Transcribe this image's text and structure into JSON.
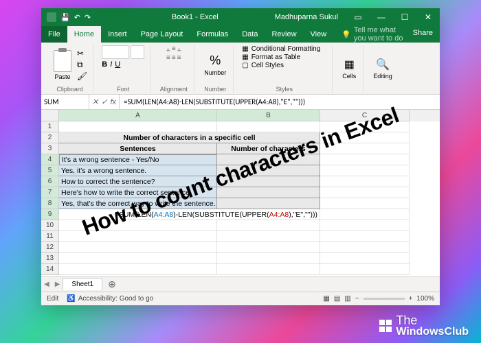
{
  "title": {
    "app": "Book1  -  Excel",
    "user": "Madhuparna Sukul"
  },
  "menu": {
    "file": "File",
    "home": "Home",
    "insert": "Insert",
    "page_layout": "Page Layout",
    "formulas": "Formulas",
    "data": "Data",
    "review": "Review",
    "view": "View",
    "tellme": "Tell me what you want to do",
    "share": "Share"
  },
  "ribbon": {
    "clipboard": {
      "paste": "Paste",
      "label": "Clipboard"
    },
    "font": {
      "label": "Font"
    },
    "alignment": {
      "label": "Alignment"
    },
    "number": {
      "btn": "Number",
      "label": "Number"
    },
    "styles": {
      "cond": "Conditional Formatting",
      "table": "Format as Table",
      "cell": "Cell Styles",
      "label": "Styles"
    },
    "cells": {
      "btn": "Cells"
    },
    "editing": {
      "btn": "Editing"
    }
  },
  "formula_bar": {
    "name": "SUM",
    "formula": "=SUM(LEN(A4:A8)-LEN(SUBSTITUTE(UPPER(A4:A8),\"E\",\"\")))"
  },
  "columns": [
    "A",
    "B",
    "C"
  ],
  "cells": {
    "r2_merged": "Number of characters in a specific cell",
    "r3_a": "Sentences",
    "r3_b": "Number of characters",
    "r4_a": "It's a wrong sentence - Yes/No",
    "r5_a": "Yes, it's a wrong sentence.",
    "r6_a": "How to correct the sentence?",
    "r7_a": "Here's how to write the correct sentence.",
    "r8_a": "Yes, that's the correct way to write the sentence.",
    "r9_formula_parts": {
      "p1": "=SUM(LEN(",
      "ref1": "A4:A8",
      "p2": ")-LEN(SUBSTITUTE(UPPER(",
      "ref2": "A4:A8",
      "p3": "),\"E\",\"\")))"
    }
  },
  "sheet": {
    "tab": "Sheet1"
  },
  "status": {
    "mode": "Edit",
    "acc": "Accessibility: Good to go",
    "zoom": "100%"
  },
  "overlay": "How to count characters in Excel",
  "watermark": {
    "l1": "The",
    "l2": "WindowsClub"
  }
}
